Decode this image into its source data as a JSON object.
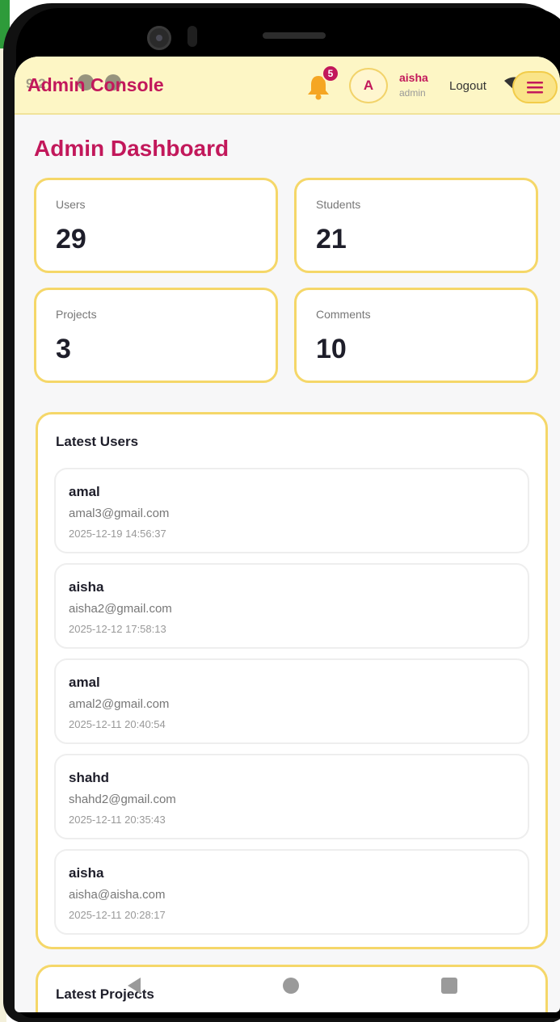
{
  "header": {
    "title": "Admin Console",
    "status_time": "9:2",
    "notification_count": "5",
    "avatar_letter": "A",
    "user_name": "aisha",
    "user_role": "admin",
    "logout_label": "Logout"
  },
  "page": {
    "title": "Admin Dashboard"
  },
  "stats": [
    {
      "label": "Users",
      "value": "29"
    },
    {
      "label": "Students",
      "value": "21"
    },
    {
      "label": "Projects",
      "value": "3"
    },
    {
      "label": "Comments",
      "value": "10"
    }
  ],
  "latest_users": {
    "title": "Latest Users",
    "items": [
      {
        "name": "amal",
        "email": "amal3@gmail.com",
        "date": "2025-12-19 14:56:37"
      },
      {
        "name": "aisha",
        "email": "aisha2@gmail.com",
        "date": "2025-12-12 17:58:13"
      },
      {
        "name": "amal",
        "email": "amal2@gmail.com",
        "date": "2025-12-11 20:40:54"
      },
      {
        "name": "shahd",
        "email": "shahd2@gmail.com",
        "date": "2025-12-11 20:35:43"
      },
      {
        "name": "aisha",
        "email": "aisha@aisha.com",
        "date": "2025-12-11 20:28:17"
      }
    ]
  },
  "latest_projects": {
    "title": "Latest Projects"
  },
  "colors": {
    "accent": "#c2185b",
    "header_bg": "#fdf6c5",
    "card_border": "#f5d769"
  }
}
